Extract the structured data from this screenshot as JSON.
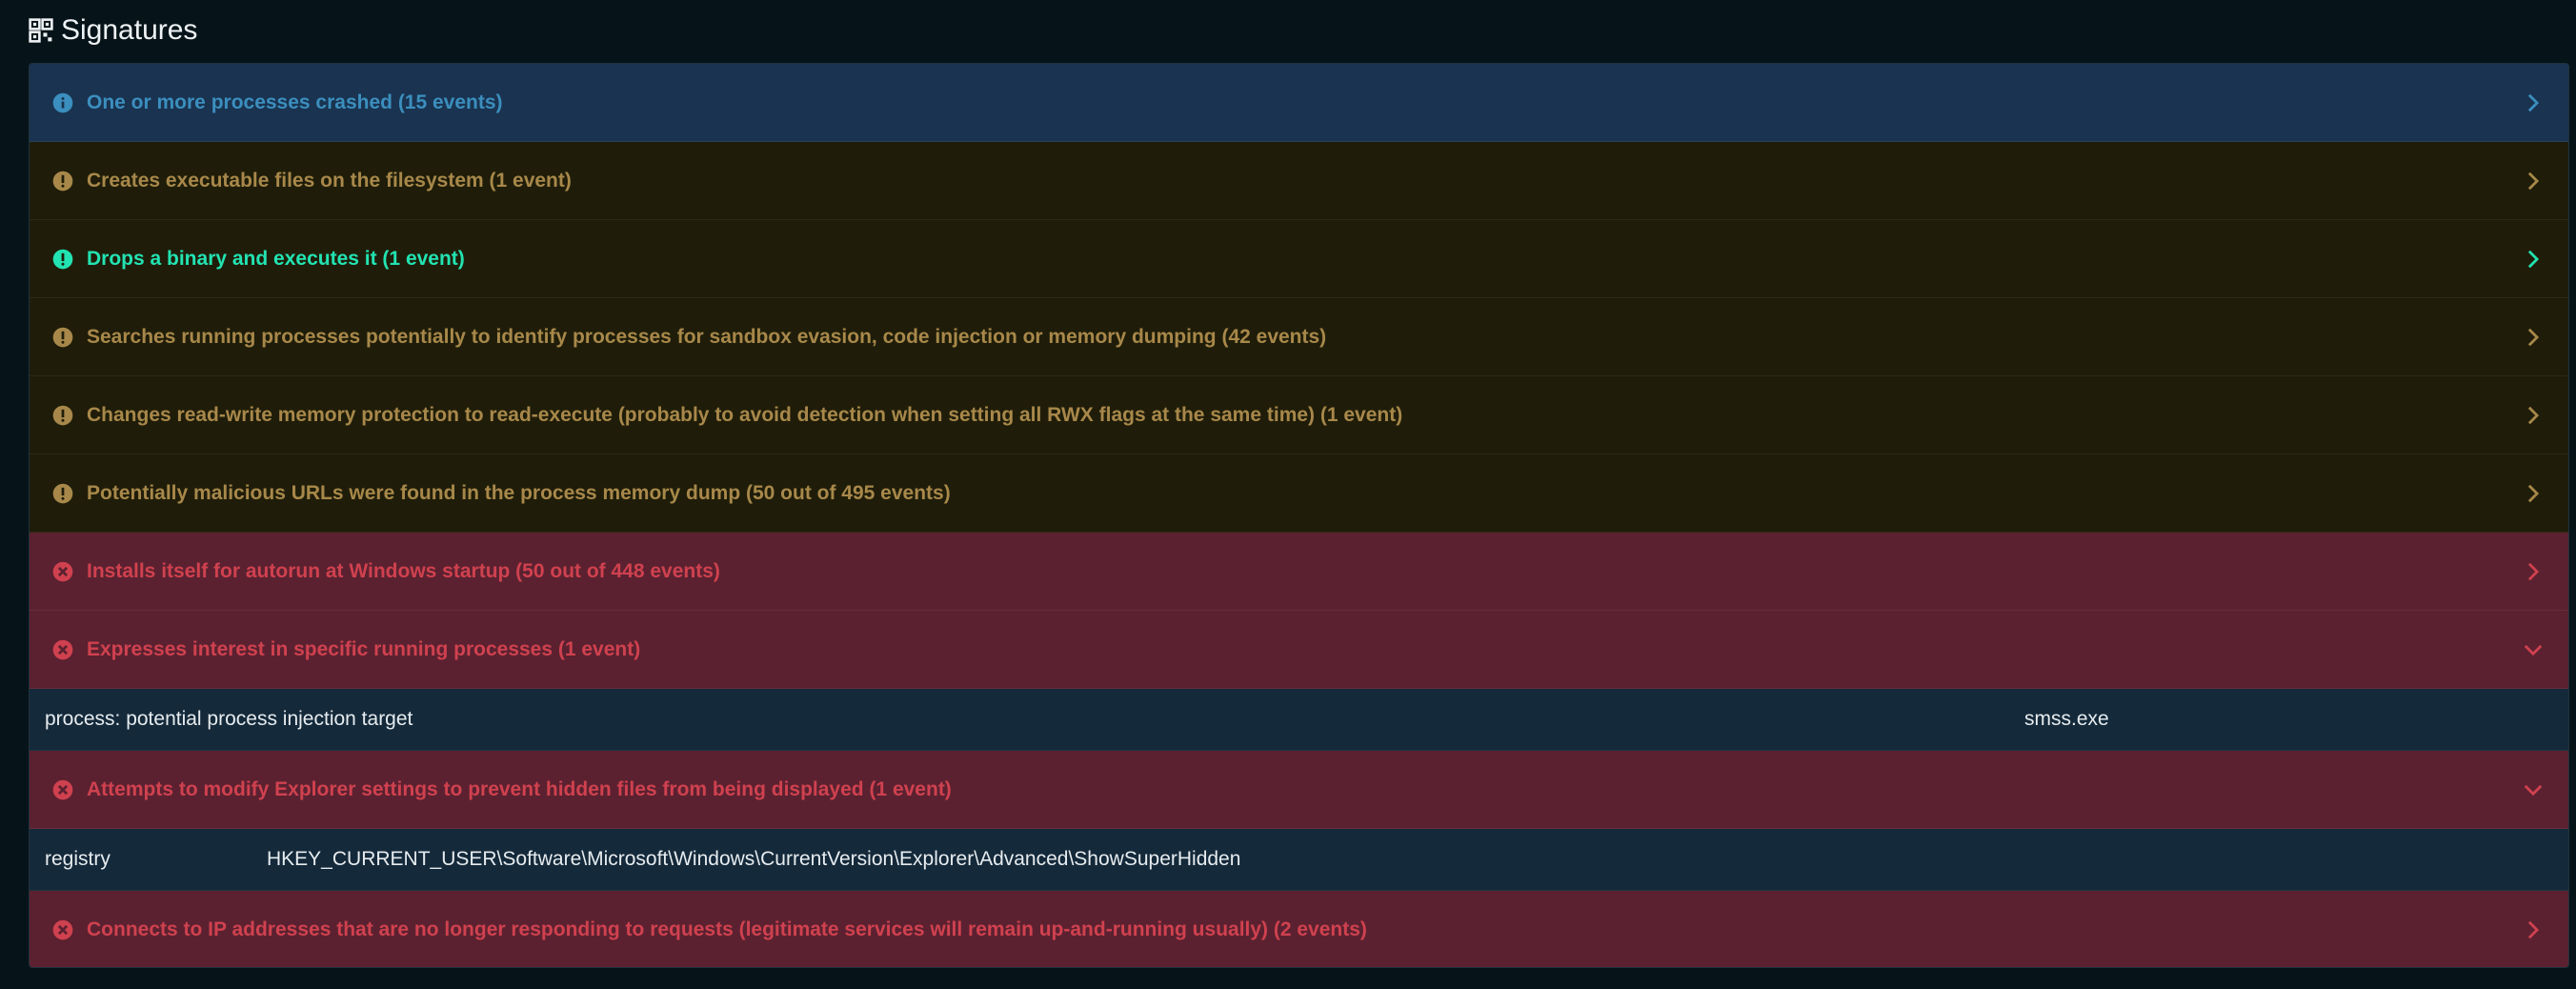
{
  "header": {
    "title": "Signatures",
    "icon": "grid-icon"
  },
  "colors": {
    "info_bg": "#1a3350",
    "info_text": "#3b8fbe",
    "warn_bg": "#1f1d09",
    "warn_text": "#a8884a",
    "good_text": "#22e3b2",
    "danger_bg": "#5b2130",
    "danger_text": "#d0414f",
    "detail_bg": "#14293a"
  },
  "signatures": [
    {
      "label": "One or more processes crashed (15 events)",
      "severity": "info",
      "icon": "info-circle-icon",
      "expanded": false
    },
    {
      "label": "Creates executable files on the filesystem (1 event)",
      "severity": "warning",
      "icon": "exclamation-circle-icon",
      "expanded": false
    },
    {
      "label": "Drops a binary and executes it (1 event)",
      "severity": "warning-highlight",
      "icon": "exclamation-circle-icon",
      "expanded": false
    },
    {
      "label": "Searches running processes potentially to identify processes for sandbox evasion, code injection or memory dumping (42 events)",
      "severity": "warning",
      "icon": "exclamation-circle-icon",
      "expanded": false
    },
    {
      "label": "Changes read-write memory protection to read-execute (probably to avoid detection when setting all RWX flags at the same time) (1 event)",
      "severity": "warning",
      "icon": "exclamation-circle-icon",
      "expanded": false
    },
    {
      "label": "Potentially malicious URLs were found in the process memory dump (50 out of 495 events)",
      "severity": "warning",
      "icon": "exclamation-circle-icon",
      "expanded": false
    },
    {
      "label": "Installs itself for autorun at Windows startup (50 out of 448 events)",
      "severity": "danger",
      "icon": "x-circle-icon",
      "expanded": false
    },
    {
      "label": "Expresses interest in specific running processes (1 event)",
      "severity": "danger",
      "icon": "x-circle-icon",
      "expanded": true,
      "detail": {
        "key": "process: potential process injection target",
        "value": "smss.exe"
      }
    },
    {
      "label": "Attempts to modify Explorer settings to prevent hidden files from being displayed (1 event)",
      "severity": "danger",
      "icon": "x-circle-icon",
      "expanded": true,
      "detail": {
        "key": "registry",
        "value": "HKEY_CURRENT_USER\\Software\\Microsoft\\Windows\\CurrentVersion\\Explorer\\Advanced\\ShowSuperHidden"
      }
    },
    {
      "label": "Connects to IP addresses that are no longer responding to requests (legitimate services will remain up-and-running usually) (2 events)",
      "severity": "danger",
      "icon": "x-circle-icon",
      "expanded": false
    }
  ]
}
